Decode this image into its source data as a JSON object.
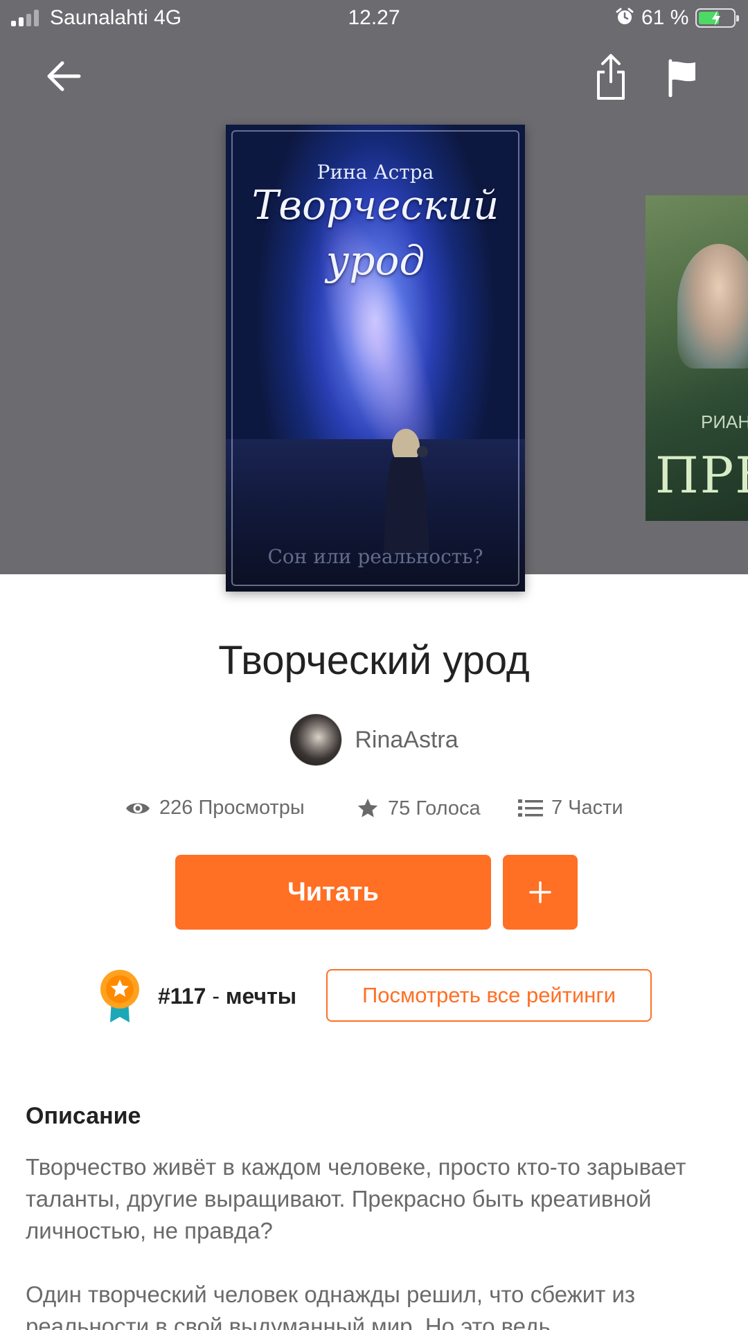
{
  "status_bar": {
    "carrier": "Saunalahti 4G",
    "time": "12.27",
    "battery": "61 %",
    "battery_level": 0.61
  },
  "nav": {
    "back_icon": "arrow-left-icon",
    "share_icon": "share-icon",
    "report_icon": "flag-icon"
  },
  "cover": {
    "author": "Рина Астра",
    "title_line1": "Творческий",
    "title_line2": "урод",
    "tagline": "Сон или реальность?"
  },
  "next_cover": {
    "author": "РИАНА",
    "title": "ПРЕЙ"
  },
  "story": {
    "title": "Творческий урод",
    "author": "RinaAstra"
  },
  "stats": {
    "views": "226 Просмотры",
    "votes": "75 Голоса",
    "parts": "7 Части"
  },
  "actions": {
    "read_label": "Читать",
    "add_label": "+"
  },
  "ranking": {
    "rank": "#117",
    "separator": " - ",
    "tag": "мечты",
    "view_all_label": "Посмотреть все рейтинги"
  },
  "description": {
    "heading": "Описание",
    "paragraph1": "Творчество живёт в каждом человеке, просто кто-то зарывает таланты, другие выращивают. Прекрасно быть креативной личностью, не правда?",
    "paragraph2": "Один творческий человек однажды решил, что сбежит из реальности в свой выдуманный мир. Но это ведь"
  },
  "colors": {
    "accent": "#ff6f24",
    "hero_bg": "#6c6b70",
    "battery_green": "#4cd964"
  }
}
